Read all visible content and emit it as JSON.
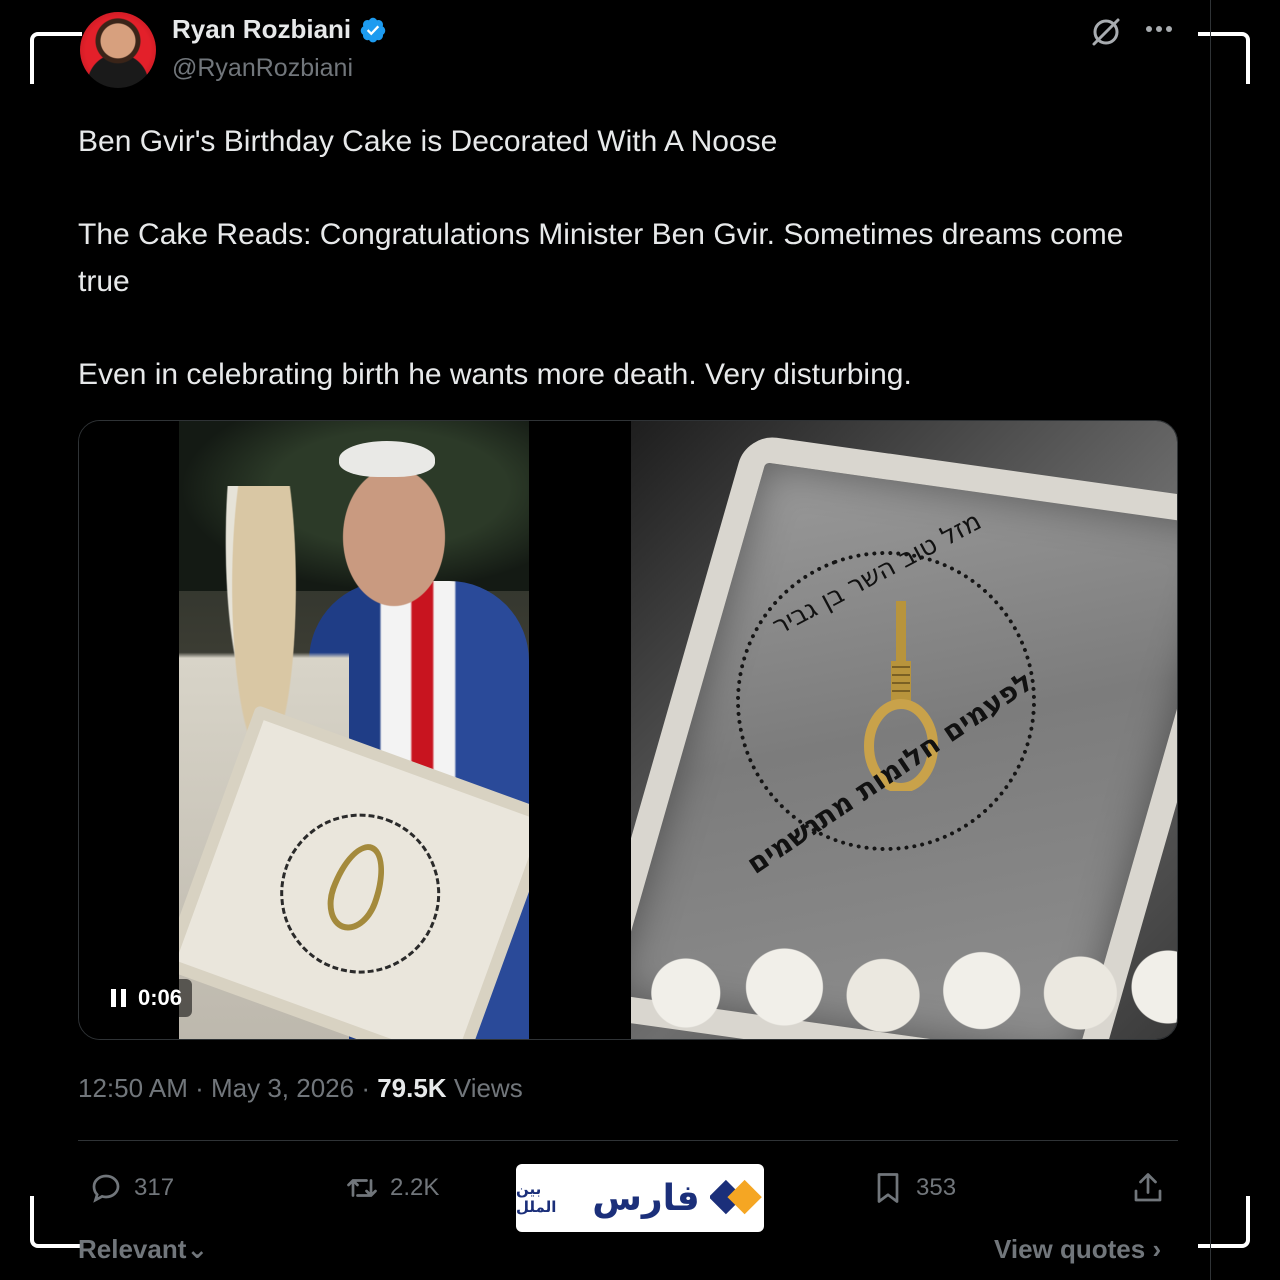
{
  "author": {
    "name": "Ryan Rozbiani",
    "handle": "@RyanRozbiani",
    "verified": true,
    "verified_color": "#1d9bf0"
  },
  "header_icons": [
    "grok-icon",
    "more-icon"
  ],
  "tweet": {
    "paragraphs": [
      "Ben Gvir's Birthday Cake is Decorated With A Noose",
      "The Cake Reads: Congratulations Minister Ben Gvir. Sometimes dreams come true",
      "Even in celebrating birth he wants more death. Very disturbing."
    ]
  },
  "media": {
    "video_time": "0:06",
    "cake_text_top": "מזל טוב השר בן גביר",
    "cake_text_bottom": "לפעמים חלומות מתגשמים"
  },
  "meta": {
    "time": "12:50 AM",
    "date": "May 3, 2026",
    "views_count": "79.5K",
    "views_label": "Views"
  },
  "actions": {
    "replies": "317",
    "retweets": "2.2K",
    "bookmarks": "353"
  },
  "watermark": {
    "primary": "فارس",
    "secondary": "بین الملل",
    "accent": "#f5a623",
    "brand": "#1b2f7a"
  },
  "footer": {
    "sort_label": "Relevant",
    "view_quotes": "View quotes"
  }
}
